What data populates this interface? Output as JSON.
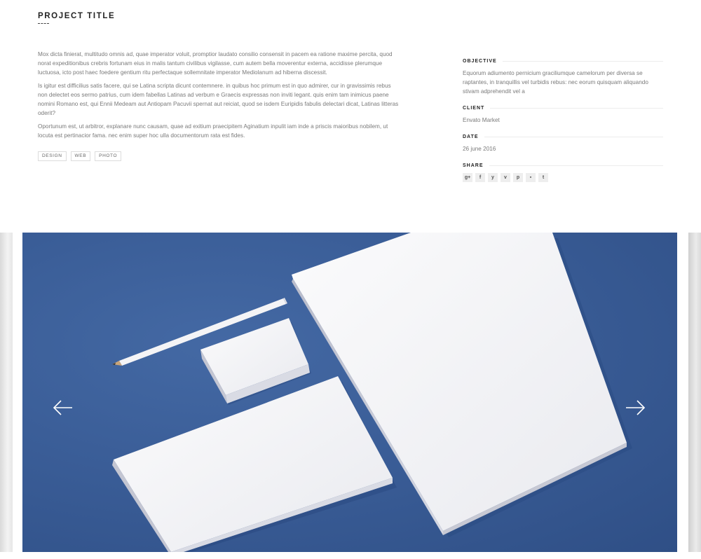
{
  "project": {
    "title": "PROJECT TITLE",
    "paragraphs": [
      "Mox dicta finierat, multitudo omnis ad, quae imperator voluit, promptior laudato consilio consensit in pacem ea ratione maxime percita, quod norat expeditionibus crebris fortunam eius in malis tantum civilibus vigilasse, cum autem bella moverentur externa, accidisse plerumque luctuosa, icto post haec foedere gentium ritu perfectaque sollemnitate imperator Mediolanum ad hiberna discessit.",
      "Is igitur est difficilius satis facere, qui se Latina scripta dicunt contemnere. in quibus hoc primum est in quo admirer, cur in gravissimis rebus non delectet eos sermo patrius, cum idem fabellas Latinas ad verbum e Graecis expressas non inviti legant. quis enim tam inimicus paene nomini Romano est, qui Ennii Medeam aut Antiopam Pacuvii spernat aut reiciat, quod se isdem Euripidis fabulis delectari dicat, Latinas litteras oderit?",
      "Oportunum est, ut arbitror, explanare nunc causam, quae ad exitium praecipitem Aginatium inpulit iam inde a priscis maioribus nobilem, ut locuta est pertinacior fama. nec enim super hoc ulla documentorum rata est fides."
    ],
    "tags": [
      "DESIGN",
      "WEB",
      "PHOTO"
    ]
  },
  "details": {
    "objective": {
      "label": "OBJECTIVE",
      "text": "Equorum adiumento pernicium graciliumque camelorum per diversa se raptantes, in tranquillis vel turbidis rebus: nec eorum quisquam aliquando stivam adprehendit vel a"
    },
    "client": {
      "label": "CLIENT",
      "text": "Envato Market"
    },
    "date": {
      "label": "DATE",
      "text": "26 june 2016"
    },
    "share": {
      "label": "SHARE",
      "icons": [
        {
          "name": "google-plus-icon",
          "glyph": "g+"
        },
        {
          "name": "facebook-icon",
          "glyph": "f"
        },
        {
          "name": "twitter-icon",
          "glyph": "y"
        },
        {
          "name": "vimeo-icon",
          "glyph": "v"
        },
        {
          "name": "pinterest-icon",
          "glyph": "p"
        },
        {
          "name": "flickr-icon",
          "glyph": "▪"
        },
        {
          "name": "tumblr-icon",
          "glyph": "t"
        }
      ]
    }
  },
  "slider": {
    "prev_icon": "arrow-left-icon",
    "next_icon": "arrow-right-icon",
    "colors": {
      "background": "#3a5d97",
      "paper": "#f7f7f9"
    }
  }
}
